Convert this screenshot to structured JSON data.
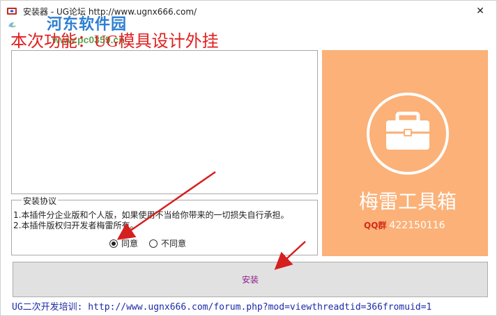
{
  "window": {
    "title": "安装器 - UG论坛 http://www.ugnx666.com/",
    "close_glyph": "✕"
  },
  "watermark": {
    "site_name": "河东软件园",
    "url": "www.pc0359.cn"
  },
  "headline": "本次功能：UG模具设计外挂",
  "agreement": {
    "legend": "安装协议",
    "lines": [
      "1.本插件分企业版和个人版，如果使用不当给你带来的一切损失自行承担。",
      "2.本插件版权归开发者梅雷所有。"
    ],
    "options": [
      {
        "label": "同意",
        "selected": true
      },
      {
        "label": "不同意",
        "selected": false
      }
    ]
  },
  "brand": {
    "name": "梅雷工具箱",
    "qq_label": "QQ群",
    "qq_number": "422150116",
    "panel_color": "#fbb178",
    "icon": "briefcase-icon"
  },
  "install_button": {
    "label": "安装"
  },
  "footer": {
    "link_text": "UG二次开发培训: http://www.ugnx666.com/forum.php?mod=viewthreadtid=366fromuid=1"
  },
  "colors": {
    "headline": "#e02020",
    "install_label": "#8b1f8b",
    "footer_link": "#1a2aa8",
    "annotation_arrow": "#d61f1f"
  }
}
